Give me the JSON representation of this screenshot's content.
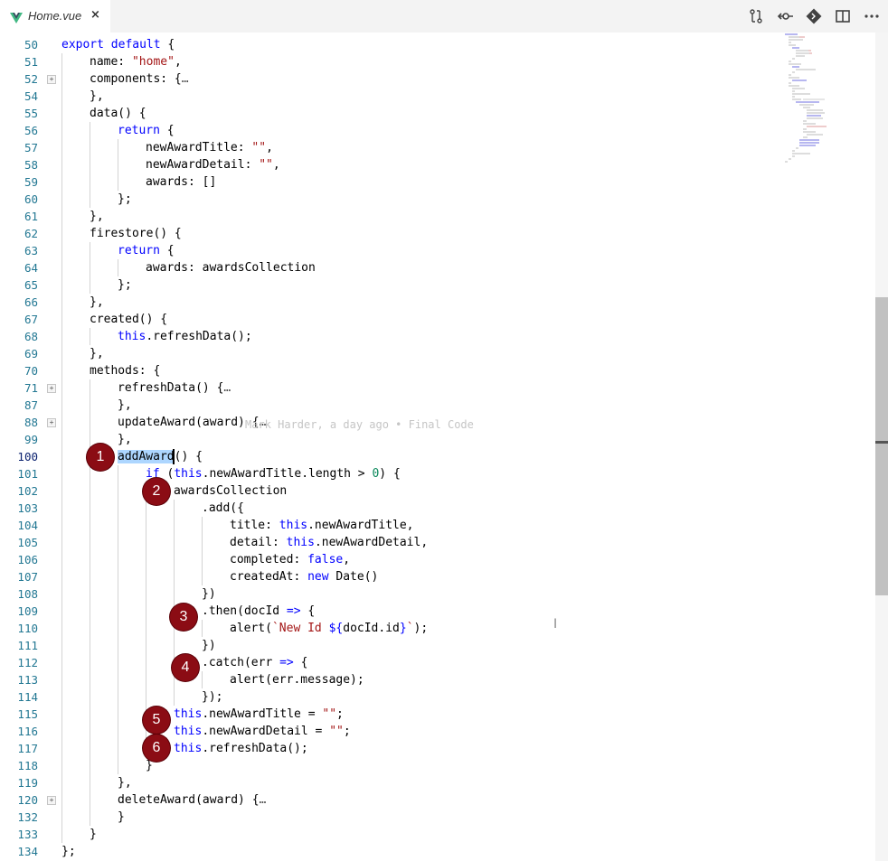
{
  "tab": {
    "title": "Home.vue",
    "close_label": "×",
    "icon": "vue-icon"
  },
  "toolbar": {
    "icons": [
      "compare-changes-icon",
      "open-changes-icon",
      "git-commit-icon",
      "split-editor-icon",
      "more-actions-icon"
    ]
  },
  "blame": {
    "text": "Mark Harder, a day ago • Final Code"
  },
  "badges": [
    "1",
    "2",
    "3",
    "4",
    "5",
    "6"
  ],
  "colors": {
    "keyword": "#0000ff",
    "string": "#a31515",
    "number": "#09885a",
    "line_number": "#237893",
    "badge": "#8b0c14",
    "selection": "#add6ff"
  },
  "lines": [
    {
      "no": "50",
      "indent": 0,
      "tokens": [
        [
          "kw",
          "export default"
        ],
        [
          "p",
          " {"
        ]
      ]
    },
    {
      "no": "51",
      "indent": 1,
      "tokens": [
        [
          "p",
          "name: "
        ],
        [
          "str",
          "\"home\""
        ],
        [
          "p",
          ","
        ]
      ]
    },
    {
      "no": "52",
      "indent": 1,
      "fold": true,
      "tokens": [
        [
          "p",
          "components: {"
        ],
        [
          "el",
          "…"
        ]
      ]
    },
    {
      "no": "54",
      "indent": 1,
      "tokens": [
        [
          "p",
          "},"
        ]
      ]
    },
    {
      "no": "55",
      "indent": 1,
      "tokens": [
        [
          "p",
          "data() {"
        ]
      ]
    },
    {
      "no": "56",
      "indent": 2,
      "tokens": [
        [
          "kw",
          "return"
        ],
        [
          "p",
          " {"
        ]
      ]
    },
    {
      "no": "57",
      "indent": 3,
      "tokens": [
        [
          "p",
          "newAwardTitle: "
        ],
        [
          "str",
          "\"\""
        ],
        [
          "p",
          ","
        ]
      ]
    },
    {
      "no": "58",
      "indent": 3,
      "tokens": [
        [
          "p",
          "newAwardDetail: "
        ],
        [
          "str",
          "\"\""
        ],
        [
          "p",
          ","
        ]
      ]
    },
    {
      "no": "59",
      "indent": 3,
      "tokens": [
        [
          "p",
          "awards: []"
        ]
      ]
    },
    {
      "no": "60",
      "indent": 2,
      "tokens": [
        [
          "p",
          "};"
        ]
      ]
    },
    {
      "no": "61",
      "indent": 1,
      "tokens": [
        [
          "p",
          "},"
        ]
      ]
    },
    {
      "no": "62",
      "indent": 1,
      "tokens": [
        [
          "p",
          "firestore() {"
        ]
      ]
    },
    {
      "no": "63",
      "indent": 2,
      "tokens": [
        [
          "kw",
          "return"
        ],
        [
          "p",
          " {"
        ]
      ]
    },
    {
      "no": "64",
      "indent": 3,
      "tokens": [
        [
          "p",
          "awards: awardsCollection"
        ]
      ]
    },
    {
      "no": "65",
      "indent": 2,
      "tokens": [
        [
          "p",
          "};"
        ]
      ]
    },
    {
      "no": "66",
      "indent": 1,
      "tokens": [
        [
          "p",
          "},"
        ]
      ]
    },
    {
      "no": "67",
      "indent": 1,
      "tokens": [
        [
          "p",
          "created() {"
        ]
      ]
    },
    {
      "no": "68",
      "indent": 2,
      "tokens": [
        [
          "kw",
          "this"
        ],
        [
          "p",
          ".refreshData();"
        ]
      ]
    },
    {
      "no": "69",
      "indent": 1,
      "tokens": [
        [
          "p",
          "},"
        ]
      ]
    },
    {
      "no": "70",
      "indent": 1,
      "tokens": [
        [
          "p",
          "methods: {"
        ]
      ]
    },
    {
      "no": "71",
      "indent": 2,
      "fold": true,
      "tokens": [
        [
          "p",
          "refreshData() {"
        ],
        [
          "el",
          "…"
        ]
      ]
    },
    {
      "no": "87",
      "indent": 2,
      "tokens": [
        [
          "p",
          "},"
        ]
      ]
    },
    {
      "no": "88",
      "indent": 2,
      "fold": true,
      "tokens": [
        [
          "p",
          "updateAward(award) {"
        ],
        [
          "el",
          "…"
        ]
      ]
    },
    {
      "no": "99",
      "indent": 2,
      "tokens": [
        [
          "p",
          "},"
        ]
      ]
    },
    {
      "no": "100",
      "indent": 2,
      "active": true,
      "tokens": [
        [
          "sel",
          "addAward"
        ],
        [
          "p",
          "() {"
        ]
      ]
    },
    {
      "no": "101",
      "indent": 3,
      "tokens": [
        [
          "kw",
          "if"
        ],
        [
          "p",
          " ("
        ],
        [
          "kw",
          "this"
        ],
        [
          "p",
          ".newAwardTitle.length > "
        ],
        [
          "num",
          "0"
        ],
        [
          "p",
          ") {"
        ]
      ]
    },
    {
      "no": "102",
      "indent": 4,
      "tokens": [
        [
          "p",
          "awardsCollection"
        ]
      ]
    },
    {
      "no": "103",
      "indent": 5,
      "tokens": [
        [
          "p",
          ".add({"
        ]
      ]
    },
    {
      "no": "104",
      "indent": 6,
      "tokens": [
        [
          "p",
          "title: "
        ],
        [
          "kw",
          "this"
        ],
        [
          "p",
          ".newAwardTitle,"
        ]
      ]
    },
    {
      "no": "105",
      "indent": 6,
      "tokens": [
        [
          "p",
          "detail: "
        ],
        [
          "kw",
          "this"
        ],
        [
          "p",
          ".newAwardDetail,"
        ]
      ]
    },
    {
      "no": "106",
      "indent": 6,
      "tokens": [
        [
          "p",
          "completed: "
        ],
        [
          "kw",
          "false"
        ],
        [
          "p",
          ","
        ]
      ]
    },
    {
      "no": "107",
      "indent": 6,
      "tokens": [
        [
          "p",
          "createdAt: "
        ],
        [
          "kw",
          "new"
        ],
        [
          "p",
          " Date()"
        ]
      ]
    },
    {
      "no": "108",
      "indent": 5,
      "tokens": [
        [
          "p",
          "})"
        ]
      ]
    },
    {
      "no": "109",
      "indent": 5,
      "tokens": [
        [
          "p",
          ".then(docId "
        ],
        [
          "kw",
          "=>"
        ],
        [
          "p",
          " {"
        ]
      ]
    },
    {
      "no": "110",
      "indent": 6,
      "tokens": [
        [
          "p",
          "alert("
        ],
        [
          "str",
          "`New Id "
        ],
        [
          "kw",
          "${"
        ],
        [
          "p",
          "docId.id"
        ],
        [
          "kw",
          "}"
        ],
        [
          "str",
          "`"
        ],
        [
          "p",
          ");"
        ]
      ]
    },
    {
      "no": "111",
      "indent": 5,
      "tokens": [
        [
          "p",
          "})"
        ]
      ]
    },
    {
      "no": "112",
      "indent": 5,
      "tokens": [
        [
          "p",
          ".catch(err "
        ],
        [
          "kw",
          "=>"
        ],
        [
          "p",
          " {"
        ]
      ]
    },
    {
      "no": "113",
      "indent": 6,
      "tokens": [
        [
          "p",
          "alert(err.message);"
        ]
      ]
    },
    {
      "no": "114",
      "indent": 5,
      "tokens": [
        [
          "p",
          "});"
        ]
      ]
    },
    {
      "no": "115",
      "indent": 4,
      "tokens": [
        [
          "kw",
          "this"
        ],
        [
          "p",
          ".newAwardTitle = "
        ],
        [
          "str",
          "\"\""
        ],
        [
          "p",
          ";"
        ]
      ]
    },
    {
      "no": "116",
      "indent": 4,
      "tokens": [
        [
          "kw",
          "this"
        ],
        [
          "p",
          ".newAwardDetail = "
        ],
        [
          "str",
          "\"\""
        ],
        [
          "p",
          ";"
        ]
      ]
    },
    {
      "no": "117",
      "indent": 4,
      "tokens": [
        [
          "kw",
          "this"
        ],
        [
          "p",
          ".refreshData();"
        ]
      ]
    },
    {
      "no": "118",
      "indent": 3,
      "tokens": [
        [
          "p",
          "}"
        ]
      ]
    },
    {
      "no": "119",
      "indent": 2,
      "tokens": [
        [
          "p",
          "},"
        ]
      ]
    },
    {
      "no": "120",
      "indent": 2,
      "fold": true,
      "tokens": [
        [
          "p",
          "deleteAward(award) {"
        ],
        [
          "el",
          "…"
        ]
      ]
    },
    {
      "no": "132",
      "indent": 2,
      "tokens": [
        [
          "p",
          "}"
        ]
      ]
    },
    {
      "no": "133",
      "indent": 1,
      "tokens": [
        [
          "p",
          "}"
        ]
      ]
    },
    {
      "no": "134",
      "indent": 0,
      "tokens": [
        [
          "p",
          "};"
        ]
      ]
    }
  ]
}
